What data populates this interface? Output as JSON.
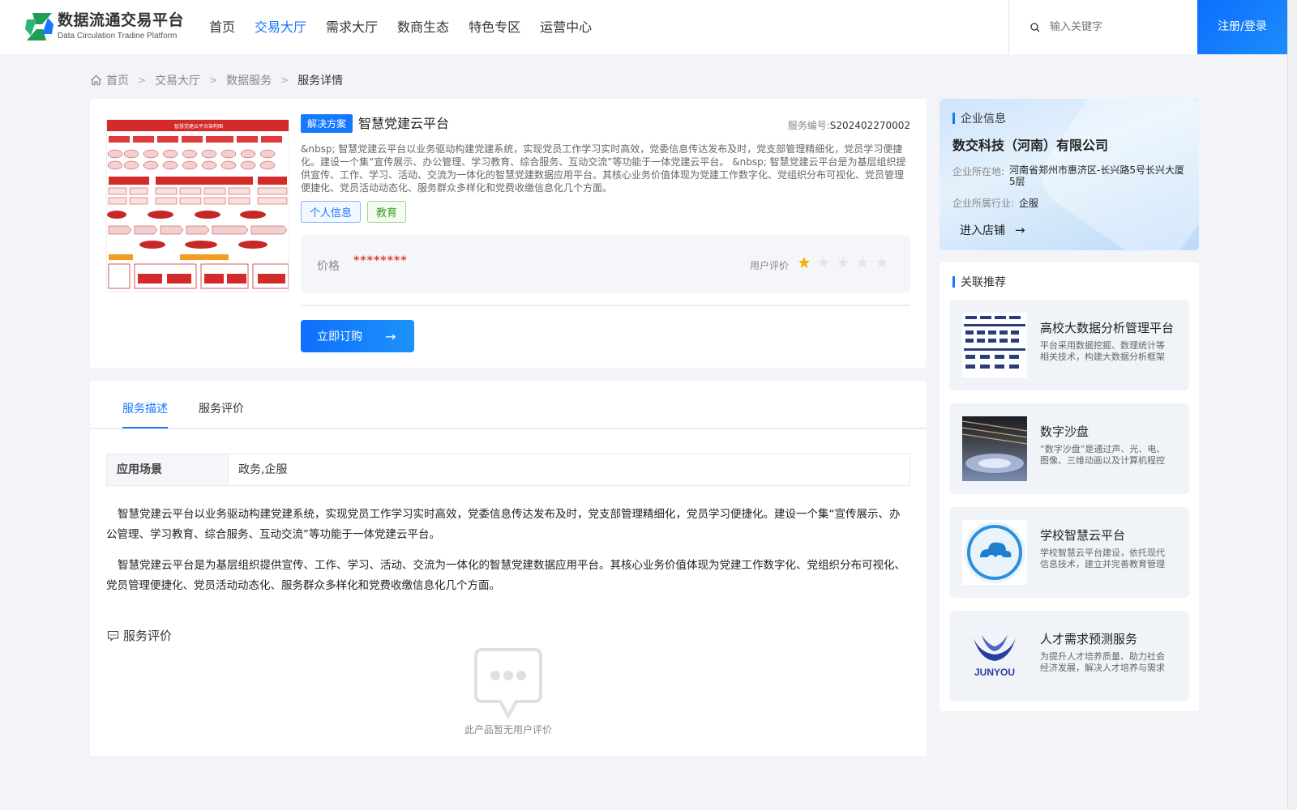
{
  "colors": {
    "accent": "#1677ff",
    "price": "#e23b3b",
    "tag_green": "#3fa022",
    "star_on": "#f5b300",
    "star_off": "#e3e5ea"
  },
  "header": {
    "logo_cn": "数据流通交易平台",
    "logo_en": "Data Circulation Tradine Platform",
    "nav": [
      "首页",
      "交易大厅",
      "需求大厅",
      "数商生态",
      "特色专区",
      "运营中心"
    ],
    "active_nav": 1,
    "search_placeholder": "输入关键字",
    "login_label": "注册/登录"
  },
  "breadcrumb": [
    "首页",
    "交易大厅",
    "数据服务",
    "服务详情"
  ],
  "product": {
    "type_tag": "解决方案",
    "title": "智慧党建云平台",
    "service_no_label": "服务编号:",
    "service_no": "S202402270002",
    "desc": "&nbsp; 智慧党建云平台以业务驱动构建党建系统，实现党员工作学习实时高效，党委信息传达发布及时，党支部管理精细化，党员学习便捷化。建设一个集“宣传展示、办公管理、学习教育、综合服务、互动交流”等功能于一体党建云平台。 &nbsp; 智慧党建云平台是为基层组织提供宣传、工作、学习、活动、交流为一体化的智慧党建数据应用平台。其核心业务价值体现为党建工作数字化、党组织分布可视化、党员管理便捷化、党员活动动态化、服务群众多样化和党费收缴信息化几个方面。",
    "tags": [
      "个人信息",
      "教育"
    ],
    "price_label": "价格",
    "price_value": "********",
    "rating_label": "用户评价",
    "rating": 1,
    "rating_max": 5,
    "buy_label": "立即订购",
    "image_title": "智慧党建云平台架构图"
  },
  "tabs": [
    "服务描述",
    "服务评价"
  ],
  "active_tab": 0,
  "scene": {
    "label": "应用场景",
    "value": "政务,企服"
  },
  "description": [
    "智慧党建云平台以业务驱动构建党建系统，实现党员工作学习实时高效，党委信息传达发布及时，党支部管理精细化，党员学习便捷化。建设一个集“宣传展示、办公管理、学习教育、综合服务、互动交流”等功能于一体党建云平台。",
    "智慧党建云平台是为基层组织提供宣传、工作、学习、活动、交流为一体化的智慧党建数据应用平台。其核心业务价值体现为党建工作数字化、党组织分布可视化、党员管理便捷化、党员活动动态化、服务群众多样化和党费收缴信息化几个方面。"
  ],
  "reviews": {
    "title": "服务评价",
    "empty_text": "此产品暂无用户评价"
  },
  "enterprise": {
    "section_title": "企业信息",
    "name": "数交科技（河南）有限公司",
    "location_label": "企业所在地:",
    "location": "河南省郑州市惠济区-长兴路5号长兴大厦5层",
    "industry_label": "企业所属行业:",
    "industry": "企服",
    "enter_label": "进入店铺"
  },
  "recommend": {
    "section_title": "关联推荐",
    "items": [
      {
        "title": "高校大数据分析管理平台",
        "desc": "平台采用数据挖掘、数理统计等相关技术，构建大数据分析框架",
        "thumb": "diagram-thumb"
      },
      {
        "title": "数字沙盘",
        "desc": "“数字沙盘”是通过声、光、电、图像、三维动画以及计算机程控技术",
        "thumb": "hall-photo-thumb"
      },
      {
        "title": "学校智慧云平台",
        "desc": "学校智慧云平台建设，依托现代信息技术，建立并完善教育管理",
        "thumb": "cloud-logo-thumb"
      },
      {
        "title": "人才需求预测服务",
        "desc": "为提升人才培养质量、助力社会经济发展，解决人才培养与需求",
        "thumb": "junyou-logo-thumb",
        "logo_text": "JUNYOU"
      }
    ]
  }
}
